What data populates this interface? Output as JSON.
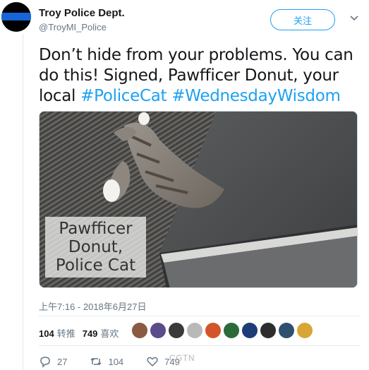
{
  "account": {
    "name": "Troy Police Dept.",
    "handle": "@TroyMI_Police",
    "follow_label": "关注"
  },
  "tweet": {
    "text_parts": {
      "p1": "Don’t hide from your problems.  You can do this!  Signed, Pawfficer Donut, your local ",
      "tag1": "#PoliceCat",
      "space": " ",
      "tag2": "#WednesdayWisdom"
    },
    "image_caption": {
      "line1": "Pawfficer",
      "line2": "Donut,",
      "line3": "Police Cat"
    },
    "timestamp": "上午7:16 - 2018年6月27日"
  },
  "stats": {
    "retweets_count": "104",
    "retweets_label": "转推",
    "likes_count": "749",
    "likes_label": "喜欢"
  },
  "likers": [
    {
      "color": "#8a5a44"
    },
    {
      "color": "#5b4b8a"
    },
    {
      "color": "#3a3a3a"
    },
    {
      "color": "#b9b9b9"
    },
    {
      "color": "#d4542a"
    },
    {
      "color": "#2b6b3a"
    },
    {
      "color": "#1d3c78"
    },
    {
      "color": "#2d2d2d"
    },
    {
      "color": "#2f4f6f"
    },
    {
      "color": "#d9a534"
    }
  ],
  "actions": {
    "reply_count": "27",
    "retweet_count": "104",
    "like_count": "749"
  },
  "watermark": "CGTN",
  "colors": {
    "accent": "#1da1f2",
    "muted": "#657786"
  }
}
